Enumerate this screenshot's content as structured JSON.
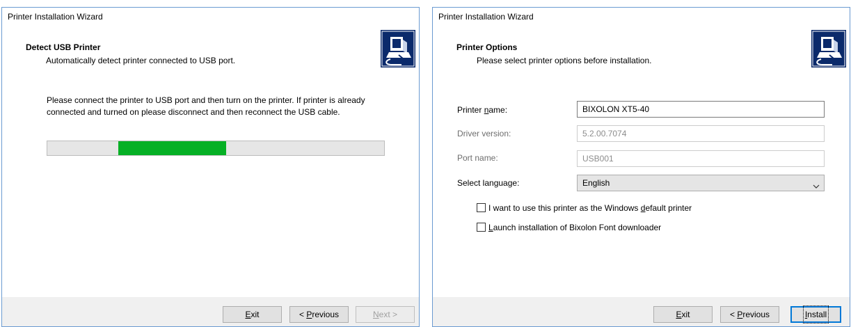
{
  "left_window": {
    "title": "Printer Installation Wizard",
    "header": {
      "title": "Detect USB Printer",
      "subtitle": "Automatically detect printer connected to USB port."
    },
    "instructions": "Please connect the printer to USB port and then turn on the printer. If printer is already connected and turned on please disconnect and then reconnect the USB cable.",
    "progress": {
      "start_fraction": 0.21,
      "end_fraction": 0.53,
      "color": "#06b025"
    },
    "buttons": {
      "exit": {
        "mnemonic": "E",
        "rest": "xit"
      },
      "previous": {
        "prefix": "< ",
        "mnemonic": "P",
        "rest": "revious"
      },
      "next": {
        "mnemonic": "N",
        "rest": "ext >",
        "disabled": true
      }
    }
  },
  "right_window": {
    "title": "Printer Installation Wizard",
    "header": {
      "title": "Printer Options",
      "subtitle": "Please select printer options before installation."
    },
    "fields": {
      "printer_name": {
        "label_pre": "Printer ",
        "label_mnemonic": "n",
        "label_post": "ame:",
        "value": "BIXOLON XT5-40"
      },
      "driver_version": {
        "label": "Driver version:",
        "value": "5.2.00.7074"
      },
      "port_name": {
        "label": "Port name:",
        "value": "USB001"
      },
      "language": {
        "label": "Select language:",
        "value": "English"
      }
    },
    "checkboxes": {
      "default_printer": {
        "pre": "I want to use this printer as the Windows ",
        "mnemonic": "d",
        "post": "efault printer",
        "checked": false
      },
      "font_downloader": {
        "mnemonic": "L",
        "post": "aunch installation of Bixolon Font downloader",
        "checked": false
      }
    },
    "buttons": {
      "exit": {
        "mnemonic": "E",
        "rest": "xit"
      },
      "previous": {
        "prefix": "< ",
        "mnemonic": "P",
        "rest": "revious"
      },
      "install": {
        "mnemonic": "I",
        "rest": "nstall"
      }
    }
  },
  "colors": {
    "window_border": "#6a9ad1",
    "footer_bg": "#f0f0f0",
    "focus_blue": "#0078d7",
    "progress_green": "#06b025"
  },
  "icons": {
    "wizard_logo": "printer-setup-icon",
    "dropdown": "chevron-down-icon"
  }
}
